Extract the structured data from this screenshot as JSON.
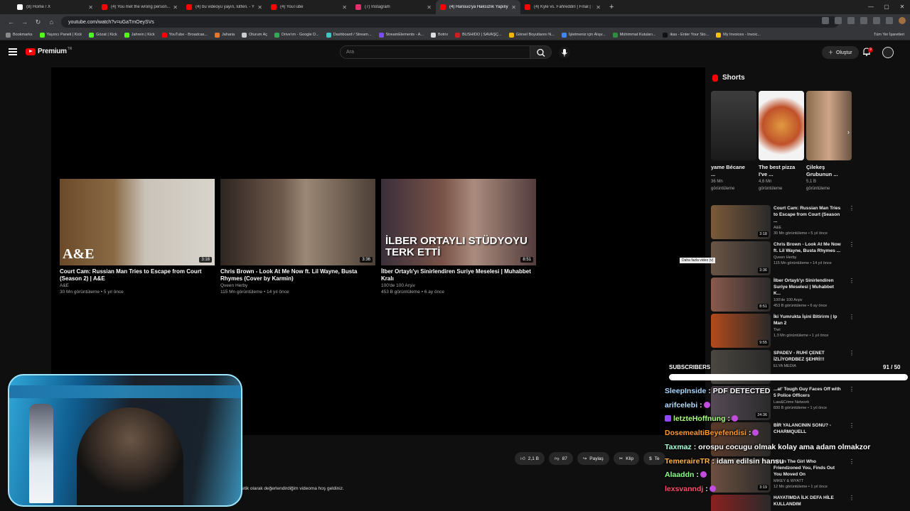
{
  "browser": {
    "tabs": [
      {
        "title": "(8) Home / X",
        "color": "#ffffff"
      },
      {
        "title": "(4) You met the wrong person...",
        "color": "#ff0000"
      },
      {
        "title": "(4) bu videoyu yayın, lütfen. - Y",
        "color": "#ff0000"
      },
      {
        "title": "(4) YouTube",
        "color": "#ff0000"
      },
      {
        "title": "(7) Instagram",
        "color": "#e1306c"
      },
      {
        "title": "(4) Hansuo'ya Haksızlık Yapılıyo",
        "color": "#ff0000"
      },
      {
        "title": "(4) Kyle vs. Fahreddin | Final | T",
        "color": "#ff0000"
      }
    ],
    "url": "youtube.com/watch?v=uGaTmOeySVs",
    "bookmarks": [
      {
        "label": "Bookmarks",
        "color": "#888888"
      },
      {
        "label": "Yayıncı Paneli | Kick",
        "color": "#53fc18"
      },
      {
        "label": "Gözat | Kick",
        "color": "#53fc18"
      },
      {
        "label": "Jahrein | Kick",
        "color": "#53fc18"
      },
      {
        "label": "YouTube - Broadcas...",
        "color": "#ff0000"
      },
      {
        "label": "Jaharia",
        "color": "#e8772e"
      },
      {
        "label": "Oturum Aç",
        "color": "#cccccc"
      },
      {
        "label": "Drive'ım - Google D...",
        "color": "#34a853"
      },
      {
        "label": "Dashboard / Stream...",
        "color": "#3ec7c0"
      },
      {
        "label": "StreamElements - A...",
        "color": "#7b4bff"
      },
      {
        "label": "Botrix",
        "color": "#dddddd"
      },
      {
        "label": "BUSHIDO | SAVAŞÇ...",
        "color": "#cc1f1f"
      },
      {
        "label": "Görsel Boyutlarını N...",
        "color": "#f4b400"
      },
      {
        "label": "İşletmeniz için Alışv...",
        "color": "#4285f4"
      },
      {
        "label": "Mühimmat Kutuları...",
        "color": "#2c8f3c"
      },
      {
        "label": "ikas - Enter Your Sto...",
        "color": "#111111"
      },
      {
        "label": "My Invoices - Invoic...",
        "color": "#f4c20d"
      }
    ],
    "all_bookmarks": "Tüm Yer İşaretleri"
  },
  "youtube": {
    "logo_word": "Premium",
    "country": "TR",
    "search_placeholder": "Ara",
    "create_label": "Oluştur",
    "notif_count": "9"
  },
  "endscreen": [
    {
      "title": "Court Cam: Russian Man Tries to Escape from Court (Season 2) | A&E",
      "channel": "A&E",
      "meta": "30 Mn görüntüleme • 5 yıl önce",
      "duration": "3:18",
      "logo": "A&E"
    },
    {
      "title": "Chris Brown - Look At Me Now ft. Lil Wayne, Busta Rhymes (Cover by Karmin)",
      "channel": "Qveen Herby",
      "meta": "115 Mn görüntüleme • 14 yıl önce",
      "duration": "3:36"
    },
    {
      "title": "İlber Ortaylı'yı Sinirlendiren Suriye Meselesi | Muhabbet Kralı",
      "channel": "100'de 100 Arşiv",
      "meta": "453 B görüntüleme • 6 ay önce",
      "duration": "8:51",
      "overlay": "İLBER ORTAYLI STÜDYOYU TERK ETTİ"
    }
  ],
  "actions": {
    "likes": "2,1 B",
    "dislikes": "87",
    "share": "Paylaş",
    "clip": "Klip",
    "thanks": "Te"
  },
  "description_fragment": "etik olarak değerlendirdiğim videoma hoş geldiniz.",
  "shorts": {
    "heading": "Shorts",
    "items": [
      {
        "title": "yame Bécane ...",
        "views": "36 Mn",
        "views_label": "görüntüleme"
      },
      {
        "title": "The best pizza I've ...",
        "views": "4,6 Mn",
        "views_label": "görüntüleme"
      },
      {
        "title": "Çilekeş Grubunun ...",
        "views": "5,1 B",
        "views_label": "görüntüleme"
      }
    ]
  },
  "related": [
    {
      "title": "Court Cam: Russian Man Tries to Escape from Court (Season ...",
      "channel": "A&E",
      "meta": "30 Mn görüntüleme • 5 yıl önce",
      "duration": "3:18",
      "color": "#7b5a3a"
    },
    {
      "title": "Chris Brown - Look At Me Now ft. Lil Wayne, Busta Rhymes ...",
      "channel": "Qveen Herby",
      "meta": "115 Mn görüntüleme • 14 yıl önce",
      "duration": "3:36",
      "color": "#6a5546"
    },
    {
      "title": "İlber Ortaylı'yı Sinirlendiren Suriye Meselesi | Muhabbet K...",
      "channel": "100'de 100 Arşiv",
      "meta": "453 B görüntüleme • 6 ay önce",
      "duration": "8:51",
      "color": "#8a5a4c"
    },
    {
      "title": "İki Yumrukta İşini Bitirirm | Ip Man 2",
      "channel": "Tiwi",
      "meta": "1,3 Mn görüntüleme • 1 yıl önce",
      "duration": "9:55",
      "color": "#b24a1c"
    },
    {
      "title": "SPADEV - RUHİ ÇENET İZLİYORDBEZ ŞEHRİ!!!",
      "channel": "ELYA MEDIA",
      "meta": "",
      "duration": "",
      "color": "#4a4640"
    },
    {
      "title": "...at' Tough Guy Faces Off with 5 Police Officers",
      "channel": "Law&Crime Network",
      "meta": "830 B görüntüleme • 1 yıl önce",
      "duration": "24:36",
      "color": "#554a55"
    },
    {
      "title": "BİR YALANCININ SONU? - CHARMQUELL",
      "channel": "",
      "meta": "",
      "duration": "",
      "color": "#5a3a2a"
    },
    {
      "title": "When The Girl Who Friendzoned You, Finds Out You Moved On",
      "channel": "MIKEY & WYATT",
      "meta": "12 Mn görüntüleme • 1 yıl önce",
      "duration": "3:19",
      "color": "#6e5040"
    },
    {
      "title": "HAYATIMDA İLK DEFA HİLE KULLANDIM",
      "channel": "",
      "meta": "",
      "duration": "",
      "color": "#8a2020"
    }
  ],
  "tooltip": "Daha fazla video (v)",
  "overlay": {
    "subs_label": "SUBSCRIBERS",
    "subs_count": "91  / 50",
    "subs_progress": 1.0,
    "chat": [
      {
        "user": "SleepInside",
        "color": "#a8d6ff",
        "msg": ": PDF DETECTED"
      },
      {
        "user": "arifcelebi",
        "color": "#b9ddff",
        "msg": ":"
      },
      {
        "user": "letzteHoffnung",
        "color": "#a8ff7c",
        "msg": ":",
        "badge": true
      },
      {
        "user": "DosemealtiBeyefendisi",
        "color": "#ff9a2e",
        "msg": ":"
      },
      {
        "user": "Taxmaz",
        "color": "#a8ffda",
        "msg": ": orospu cocugu olmak kolay ama adam olmakzor"
      },
      {
        "user": "TemeraireTR",
        "color": "#ffb347",
        "msg": ": idam edilsin hansu"
      },
      {
        "user": "Alaaddn",
        "color": "#8cff8c",
        "msg": ":"
      },
      {
        "user": "lexsvanndj",
        "color": "#ff4f6a",
        "msg": ":"
      }
    ]
  }
}
